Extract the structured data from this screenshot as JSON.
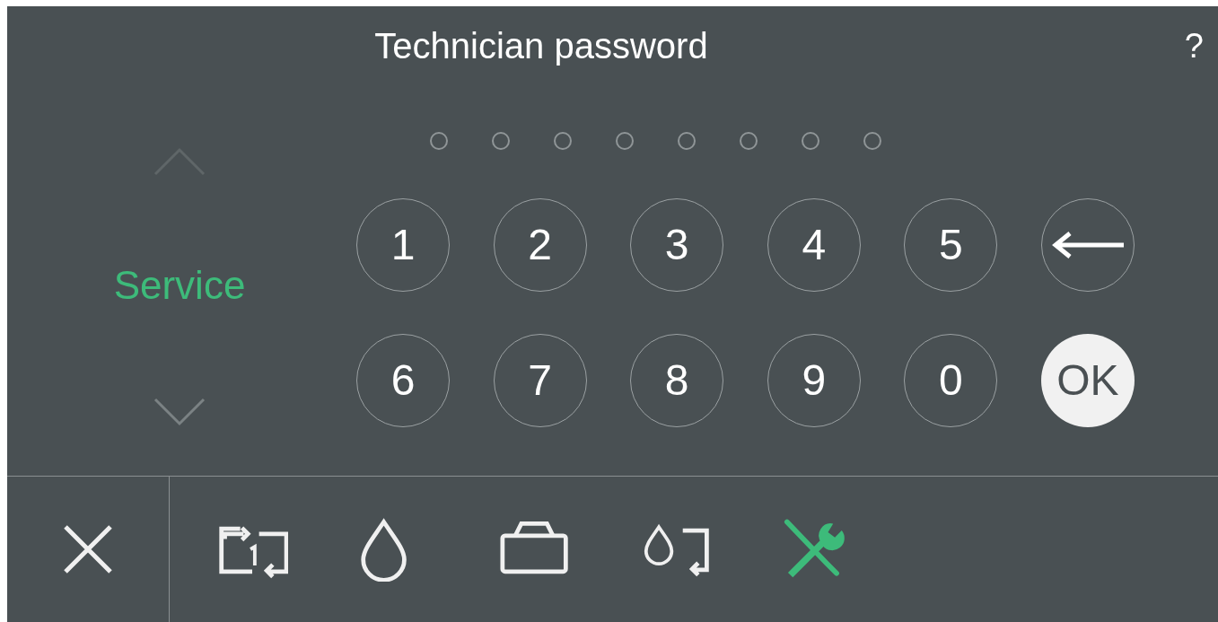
{
  "header": {
    "title": "Technician password",
    "help": "?"
  },
  "pin_dots": [
    {
      "filled": false
    },
    {
      "filled": false
    },
    {
      "filled": false
    },
    {
      "filled": false
    },
    {
      "filled": false
    },
    {
      "filled": false
    },
    {
      "filled": false
    },
    {
      "filled": false
    }
  ],
  "menu": {
    "scroll_up": {
      "disabled": true
    },
    "label": "Service",
    "scroll_down": {
      "disabled": false
    }
  },
  "keypad": [
    {
      "kind": "digit",
      "label": "1"
    },
    {
      "kind": "digit",
      "label": "2"
    },
    {
      "kind": "digit",
      "label": "3"
    },
    {
      "kind": "digit",
      "label": "4"
    },
    {
      "kind": "digit",
      "label": "5"
    },
    {
      "kind": "backspace"
    },
    {
      "kind": "digit",
      "label": "6"
    },
    {
      "kind": "digit",
      "label": "7"
    },
    {
      "kind": "digit",
      "label": "8"
    },
    {
      "kind": "digit",
      "label": "9"
    },
    {
      "kind": "digit",
      "label": "0"
    },
    {
      "kind": "ok",
      "label": "OK"
    }
  ],
  "toolbar": [
    {
      "kind": "copy",
      "selected": false
    },
    {
      "kind": "ink",
      "selected": false
    },
    {
      "kind": "case",
      "selected": false
    },
    {
      "kind": "ink_copy",
      "selected": false
    },
    {
      "kind": "tools",
      "selected": true
    }
  ]
}
